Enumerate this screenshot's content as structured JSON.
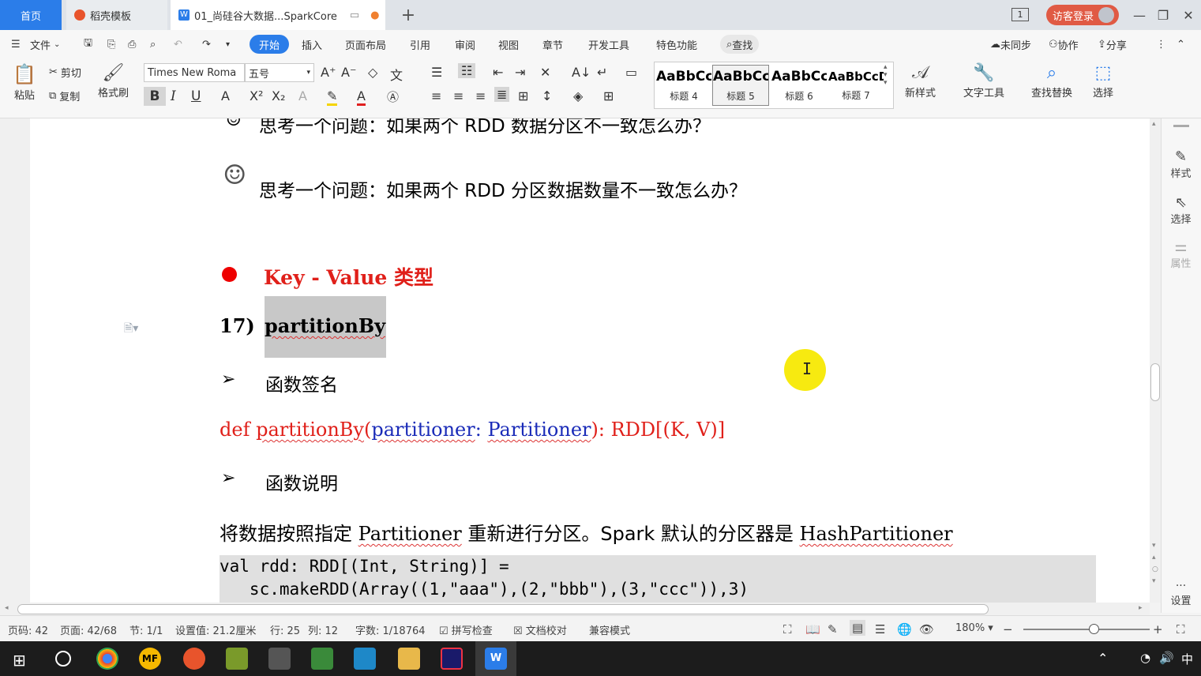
{
  "titlebar": {
    "tabs": [
      {
        "label": "首页"
      },
      {
        "label": "稻壳模板"
      },
      {
        "label": "01_尚硅谷大数据...SparkCore"
      }
    ],
    "login_label": "访客登录",
    "page_indicator": "1"
  },
  "menu": {
    "file": "文件",
    "items": [
      "开始",
      "插入",
      "页面布局",
      "引用",
      "审阅",
      "视图",
      "章节",
      "开发工具",
      "特色功能"
    ],
    "search": "查找",
    "sync": "未同步",
    "collab": "协作",
    "share": "分享"
  },
  "ribbon": {
    "paste": "粘贴",
    "cut": "剪切",
    "copy": "复制",
    "format_painter": "格式刷",
    "font_name": "Times New Roma",
    "font_size": "五号",
    "styles": [
      {
        "preview": "AaBbCcD",
        "name": "标题 4"
      },
      {
        "preview": "AaBbCcD",
        "name": "标题 5"
      },
      {
        "preview": "AaBbCcD",
        "name": "标题 6"
      },
      {
        "preview": "AaBbCcD",
        "name": "标题 7"
      }
    ],
    "new_style": "新样式",
    "text_tools": "文字工具",
    "find_replace": "查找替换",
    "select": "选择"
  },
  "document": {
    "question1": "思考一个问题：如果两个 RDD 数据分区不一致怎么办？",
    "question2": "思考一个问题：如果两个 RDD 分区数据数量不一致怎么办？",
    "section_title": "Key - Value 类型",
    "item_number": "17)",
    "item_name": "partitionBy",
    "signature_heading": "函数签名",
    "signature": {
      "def": "def ",
      "name": "partitionBy",
      "open": "(",
      "param": "partitioner",
      "colon": ": ",
      "type": "Partitioner",
      "close": "): RDD[(K, V)]"
    },
    "desc_heading": "函数说明",
    "desc_parts": [
      "将数据按照指定 ",
      "Partitioner",
      " 重新进行分区。Spark 默认的分区器是 ",
      "HashPartitioner"
    ],
    "code_lines": [
      "val rdd: RDD[(Int, String)] =",
      "   sc.makeRDD(Array((1,\"aaa\"),(2,\"bbb\"),(3,\"ccc\")),3)"
    ]
  },
  "right_panel": {
    "style": "样式",
    "select": "选择",
    "property": "属性",
    "settings": "设置"
  },
  "statusbar": {
    "page_code": "页码: 42",
    "page": "页面: 42/68",
    "section": "节: 1/1",
    "setting": "设置值: 21.2厘米",
    "row": "行: 25",
    "col": "列: 12",
    "wordcount": "字数: 1/18764",
    "spellcheck": "拼写检查",
    "proofread": "文档校对",
    "compat": "兼容模式",
    "zoom": "180%"
  },
  "taskbar": {
    "ime": "中"
  }
}
